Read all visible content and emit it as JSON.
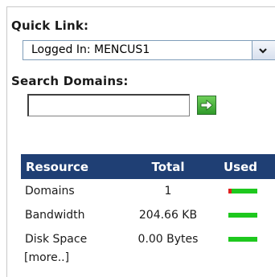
{
  "quick_link": {
    "title": "Quick Link:",
    "selected": "Logged In: MENCUS1"
  },
  "search": {
    "title": "Search Domains:",
    "value": "",
    "placeholder": ""
  },
  "resource_table": {
    "headers": [
      "Resource",
      "Total",
      "Used"
    ],
    "rows": [
      {
        "resource": "Domains",
        "total": "1",
        "used_fraction": 0.1
      },
      {
        "resource": "Bandwidth",
        "total": "204.66 KB",
        "used_fraction": 0.0
      },
      {
        "resource": "Disk Space",
        "total": "0.00 Bytes",
        "used_fraction": 0.0
      }
    ],
    "more_link": "[more..]"
  },
  "colors": {
    "header_bg": "#1f3f74",
    "bar_free": "#1ec81e",
    "bar_used": "#e02020",
    "go_button": "#2f9a2a"
  },
  "icons": {
    "dropdown": "chevron-down-icon",
    "go": "arrow-right-icon"
  }
}
